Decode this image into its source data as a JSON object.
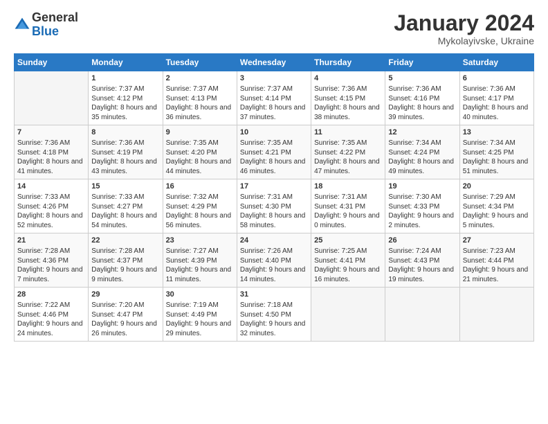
{
  "logo": {
    "general": "General",
    "blue": "Blue"
  },
  "title": {
    "month_year": "January 2024",
    "location": "Mykolayivske, Ukraine"
  },
  "days_of_week": [
    "Sunday",
    "Monday",
    "Tuesday",
    "Wednesday",
    "Thursday",
    "Friday",
    "Saturday"
  ],
  "weeks": [
    [
      {
        "day": "",
        "sunrise": "",
        "sunset": "",
        "daylight": ""
      },
      {
        "day": "1",
        "sunrise": "Sunrise: 7:37 AM",
        "sunset": "Sunset: 4:12 PM",
        "daylight": "Daylight: 8 hours and 35 minutes."
      },
      {
        "day": "2",
        "sunrise": "Sunrise: 7:37 AM",
        "sunset": "Sunset: 4:13 PM",
        "daylight": "Daylight: 8 hours and 36 minutes."
      },
      {
        "day": "3",
        "sunrise": "Sunrise: 7:37 AM",
        "sunset": "Sunset: 4:14 PM",
        "daylight": "Daylight: 8 hours and 37 minutes."
      },
      {
        "day": "4",
        "sunrise": "Sunrise: 7:36 AM",
        "sunset": "Sunset: 4:15 PM",
        "daylight": "Daylight: 8 hours and 38 minutes."
      },
      {
        "day": "5",
        "sunrise": "Sunrise: 7:36 AM",
        "sunset": "Sunset: 4:16 PM",
        "daylight": "Daylight: 8 hours and 39 minutes."
      },
      {
        "day": "6",
        "sunrise": "Sunrise: 7:36 AM",
        "sunset": "Sunset: 4:17 PM",
        "daylight": "Daylight: 8 hours and 40 minutes."
      }
    ],
    [
      {
        "day": "7",
        "sunrise": "Sunrise: 7:36 AM",
        "sunset": "Sunset: 4:18 PM",
        "daylight": "Daylight: 8 hours and 41 minutes."
      },
      {
        "day": "8",
        "sunrise": "Sunrise: 7:36 AM",
        "sunset": "Sunset: 4:19 PM",
        "daylight": "Daylight: 8 hours and 43 minutes."
      },
      {
        "day": "9",
        "sunrise": "Sunrise: 7:35 AM",
        "sunset": "Sunset: 4:20 PM",
        "daylight": "Daylight: 8 hours and 44 minutes."
      },
      {
        "day": "10",
        "sunrise": "Sunrise: 7:35 AM",
        "sunset": "Sunset: 4:21 PM",
        "daylight": "Daylight: 8 hours and 46 minutes."
      },
      {
        "day": "11",
        "sunrise": "Sunrise: 7:35 AM",
        "sunset": "Sunset: 4:22 PM",
        "daylight": "Daylight: 8 hours and 47 minutes."
      },
      {
        "day": "12",
        "sunrise": "Sunrise: 7:34 AM",
        "sunset": "Sunset: 4:24 PM",
        "daylight": "Daylight: 8 hours and 49 minutes."
      },
      {
        "day": "13",
        "sunrise": "Sunrise: 7:34 AM",
        "sunset": "Sunset: 4:25 PM",
        "daylight": "Daylight: 8 hours and 51 minutes."
      }
    ],
    [
      {
        "day": "14",
        "sunrise": "Sunrise: 7:33 AM",
        "sunset": "Sunset: 4:26 PM",
        "daylight": "Daylight: 8 hours and 52 minutes."
      },
      {
        "day": "15",
        "sunrise": "Sunrise: 7:33 AM",
        "sunset": "Sunset: 4:27 PM",
        "daylight": "Daylight: 8 hours and 54 minutes."
      },
      {
        "day": "16",
        "sunrise": "Sunrise: 7:32 AM",
        "sunset": "Sunset: 4:29 PM",
        "daylight": "Daylight: 8 hours and 56 minutes."
      },
      {
        "day": "17",
        "sunrise": "Sunrise: 7:31 AM",
        "sunset": "Sunset: 4:30 PM",
        "daylight": "Daylight: 8 hours and 58 minutes."
      },
      {
        "day": "18",
        "sunrise": "Sunrise: 7:31 AM",
        "sunset": "Sunset: 4:31 PM",
        "daylight": "Daylight: 9 hours and 0 minutes."
      },
      {
        "day": "19",
        "sunrise": "Sunrise: 7:30 AM",
        "sunset": "Sunset: 4:33 PM",
        "daylight": "Daylight: 9 hours and 2 minutes."
      },
      {
        "day": "20",
        "sunrise": "Sunrise: 7:29 AM",
        "sunset": "Sunset: 4:34 PM",
        "daylight": "Daylight: 9 hours and 5 minutes."
      }
    ],
    [
      {
        "day": "21",
        "sunrise": "Sunrise: 7:28 AM",
        "sunset": "Sunset: 4:36 PM",
        "daylight": "Daylight: 9 hours and 7 minutes."
      },
      {
        "day": "22",
        "sunrise": "Sunrise: 7:28 AM",
        "sunset": "Sunset: 4:37 PM",
        "daylight": "Daylight: 9 hours and 9 minutes."
      },
      {
        "day": "23",
        "sunrise": "Sunrise: 7:27 AM",
        "sunset": "Sunset: 4:39 PM",
        "daylight": "Daylight: 9 hours and 11 minutes."
      },
      {
        "day": "24",
        "sunrise": "Sunrise: 7:26 AM",
        "sunset": "Sunset: 4:40 PM",
        "daylight": "Daylight: 9 hours and 14 minutes."
      },
      {
        "day": "25",
        "sunrise": "Sunrise: 7:25 AM",
        "sunset": "Sunset: 4:41 PM",
        "daylight": "Daylight: 9 hours and 16 minutes."
      },
      {
        "day": "26",
        "sunrise": "Sunrise: 7:24 AM",
        "sunset": "Sunset: 4:43 PM",
        "daylight": "Daylight: 9 hours and 19 minutes."
      },
      {
        "day": "27",
        "sunrise": "Sunrise: 7:23 AM",
        "sunset": "Sunset: 4:44 PM",
        "daylight": "Daylight: 9 hours and 21 minutes."
      }
    ],
    [
      {
        "day": "28",
        "sunrise": "Sunrise: 7:22 AM",
        "sunset": "Sunset: 4:46 PM",
        "daylight": "Daylight: 9 hours and 24 minutes."
      },
      {
        "day": "29",
        "sunrise": "Sunrise: 7:20 AM",
        "sunset": "Sunset: 4:47 PM",
        "daylight": "Daylight: 9 hours and 26 minutes."
      },
      {
        "day": "30",
        "sunrise": "Sunrise: 7:19 AM",
        "sunset": "Sunset: 4:49 PM",
        "daylight": "Daylight: 9 hours and 29 minutes."
      },
      {
        "day": "31",
        "sunrise": "Sunrise: 7:18 AM",
        "sunset": "Sunset: 4:50 PM",
        "daylight": "Daylight: 9 hours and 32 minutes."
      },
      {
        "day": "",
        "sunrise": "",
        "sunset": "",
        "daylight": ""
      },
      {
        "day": "",
        "sunrise": "",
        "sunset": "",
        "daylight": ""
      },
      {
        "day": "",
        "sunrise": "",
        "sunset": "",
        "daylight": ""
      }
    ]
  ]
}
